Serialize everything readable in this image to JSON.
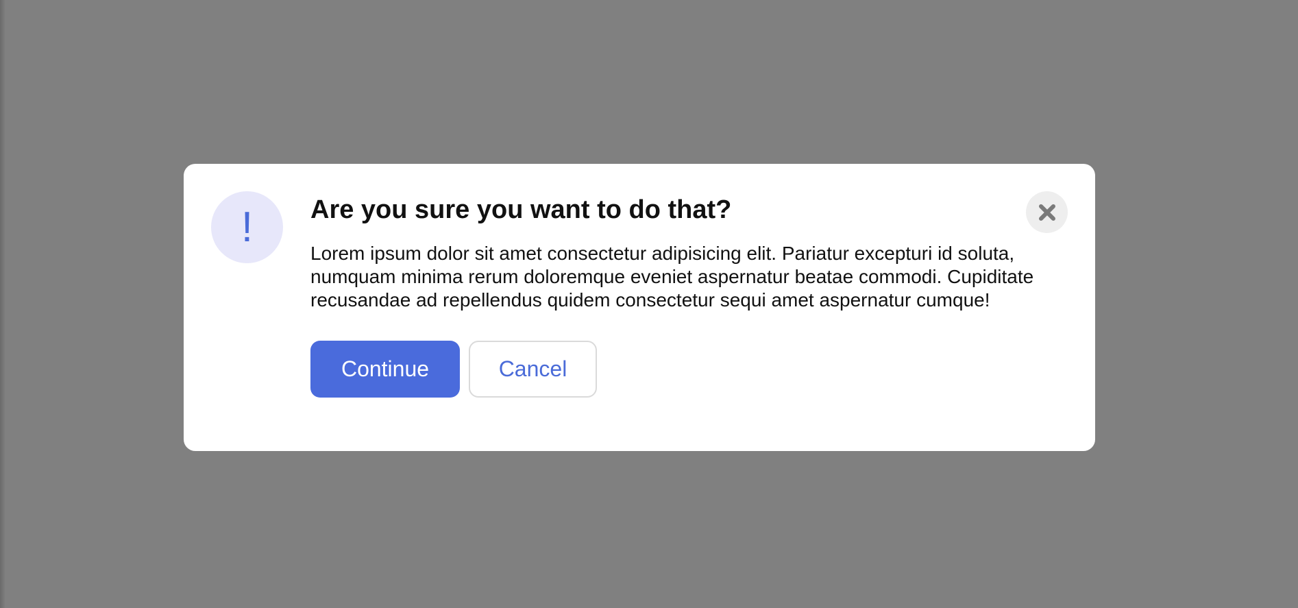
{
  "dialog": {
    "icon": "exclamation-icon",
    "icon_glyph": "!",
    "title": "Are you sure you want to do that?",
    "message": "Lorem ipsum dolor sit amet consectetur adipisicing elit. Pariatur excepturi id soluta, numquam minima rerum doloremque eveniet aspernatur beatae commodi. Cupiditate recusandae ad repellendus quidem consectetur sequi amet aspernatur cumque!",
    "continue_label": "Continue",
    "cancel_label": "Cancel",
    "close_icon": "close-icon"
  },
  "colors": {
    "overlay": "#808080",
    "accent": "#4a6bdc",
    "icon_background": "#e7e7fa",
    "close_background": "#eeeeee"
  }
}
